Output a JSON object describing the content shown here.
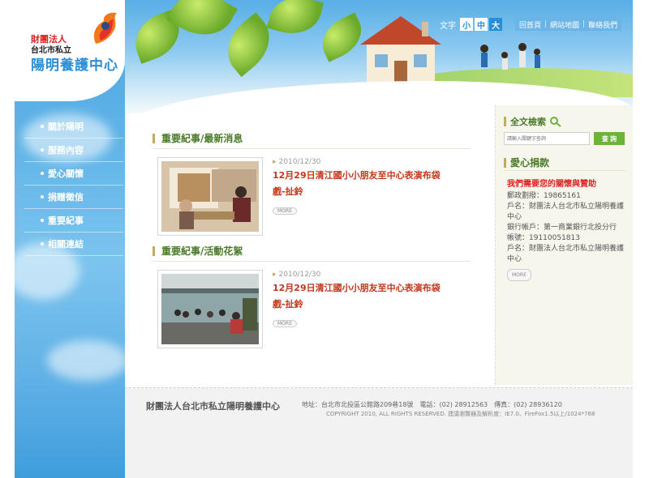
{
  "logo": {
    "line1": "財團法人",
    "line2": "台北市私立",
    "line3": "陽明養護中心"
  },
  "nav": {
    "items": [
      {
        "label": "關於陽明"
      },
      {
        "label": "服務內容"
      },
      {
        "label": "愛心關懷"
      },
      {
        "label": "捐贈徵信"
      },
      {
        "label": "重要紀事"
      },
      {
        "label": "相關連結"
      }
    ]
  },
  "utility": {
    "font_label": "文字",
    "sizes": [
      "小",
      "中",
      "大"
    ],
    "active_size": "大",
    "links": [
      "回首頁",
      "網站地圖",
      "聯絡我們"
    ]
  },
  "sections": [
    {
      "title": "重要紀事/最新消息",
      "date": "2010/12/30",
      "headline": "12月29日清江國小小朋友至中心表演布袋戲-扯鈴",
      "more": "MORE"
    },
    {
      "title": "重要紀事/活動花絮",
      "date": "2010/12/30",
      "headline": "12月29日清江國小小朋友至中心表演布袋戲-扯鈴",
      "more": "MORE"
    }
  ],
  "search": {
    "title": "全文檢索",
    "placeholder": "請輸入關鍵字查詢",
    "button": "查 詢"
  },
  "donate": {
    "title": "愛心捐款",
    "headline": "我們需要您的關懷與贊助",
    "lines": [
      "郵政劃撥：19865161",
      "戶名：財團法人台北市私立陽明養護中心",
      "銀行帳戶：第一商業銀行北投分行",
      "帳號：19110051813",
      "戶名：財團法人台北市私立陽明養護中心"
    ],
    "more": "MORE"
  },
  "footer": {
    "org": "財團法人台北市私立陽明養護中心",
    "address": "地址：台北市北投區公館路209巷18號　電話：(02) 28912563　傳真：(02) 28936120",
    "copyright": "COPYRIGHT 2010, ALL RIGHTS RESERVED.  建議瀏覽器及解析度：IE7.0、FireFox1.5以上/1024*768"
  },
  "colors": {
    "sky": "#4aa6e0",
    "accent_green": "#4a7a2a",
    "headline_red": "#c3381b",
    "donate_red": "#dd2222"
  }
}
